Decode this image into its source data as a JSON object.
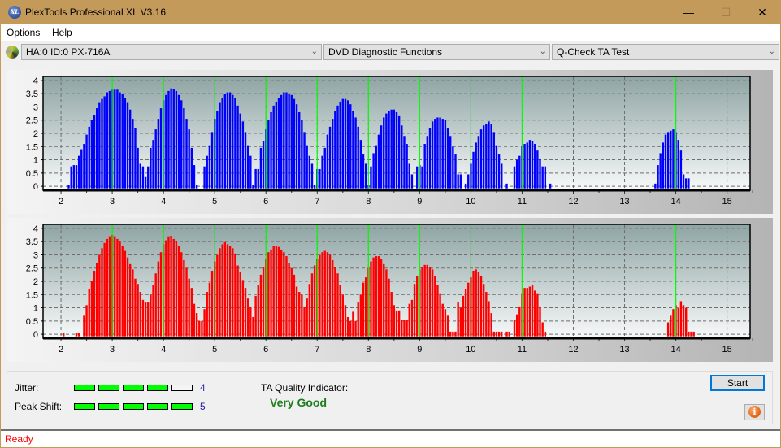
{
  "window": {
    "title": "PlexTools Professional XL V3.16",
    "app_icon": "xl-logo-icon",
    "controls": {
      "minimize": "—",
      "maximize": "☐",
      "close": "✕"
    }
  },
  "menu": {
    "items": [
      {
        "label": "Options"
      },
      {
        "label": "Help"
      }
    ]
  },
  "toolbar": {
    "drive_icon": "disc-drive-icon",
    "drive": "HA:0 ID:0  PX-716A",
    "function": "DVD Diagnostic Functions",
    "test": "Q-Check TA Test"
  },
  "colors": {
    "top_bars": "#0000ff",
    "bottom_bars": "#ff0000",
    "marker_lines": "#00ff00",
    "status_text": "#ff0000",
    "quality_text": "#1e7d1e"
  },
  "chart_data": [
    {
      "type": "bar",
      "name": "TA histogram (top)",
      "color": "#0000ff",
      "xlim": [
        1.65,
        15.45
      ],
      "ylim": [
        -0.15,
        4.15
      ],
      "xticks": [
        2,
        3,
        4,
        5,
        6,
        7,
        8,
        9,
        10,
        11,
        12,
        13,
        14,
        15
      ],
      "yticks": [
        0,
        0.5,
        1,
        1.5,
        2,
        2.5,
        3,
        3.5,
        4
      ],
      "ytick_labels": [
        "0",
        "0.5",
        "1",
        "1.5",
        "2",
        "2.5",
        "3",
        "3.5",
        "4"
      ],
      "marker_lines_x": [
        3,
        4,
        5,
        6,
        7,
        8,
        9,
        10,
        11,
        14
      ],
      "grid": true,
      "x_start": 2.15,
      "x_step": 0.05,
      "values": [
        0.05,
        0.75,
        0.8,
        0.8,
        1.15,
        1.4,
        1.6,
        1.95,
        2.25,
        2.5,
        2.7,
        2.95,
        3.15,
        3.3,
        3.4,
        3.55,
        3.6,
        3.65,
        3.65,
        3.65,
        3.55,
        3.5,
        3.35,
        3.15,
        2.9,
        2.55,
        2.2,
        1.45,
        0.85,
        0.75,
        0.35,
        0.75,
        1.45,
        1.75,
        2.15,
        2.55,
        2.95,
        3.25,
        3.45,
        3.6,
        3.7,
        3.68,
        3.6,
        3.45,
        3.25,
        2.95,
        2.55,
        2.15,
        1.45,
        0.8,
        0.05,
        0,
        0,
        0.75,
        1.15,
        1.55,
        2.05,
        2.55,
        2.85,
        3.15,
        3.35,
        3.5,
        3.55,
        3.55,
        3.45,
        3.35,
        3.05,
        2.75,
        2.45,
        2.05,
        1.55,
        1.15,
        0.05,
        0.65,
        0.65,
        1.45,
        1.7,
        2.15,
        2.5,
        2.8,
        3.05,
        3.2,
        3.35,
        3.45,
        3.55,
        3.55,
        3.5,
        3.45,
        3.3,
        3.1,
        2.8,
        2.5,
        2.05,
        1.55,
        1.15,
        0.85,
        0.05,
        0.65,
        0.65,
        1.15,
        1.45,
        1.95,
        2.25,
        2.55,
        2.85,
        3.05,
        3.2,
        3.3,
        3.3,
        3.25,
        3.1,
        2.85,
        2.6,
        2.25,
        1.75,
        1.2,
        0.85,
        0.05,
        0.75,
        1.25,
        1.55,
        1.95,
        2.3,
        2.6,
        2.75,
        2.85,
        2.9,
        2.9,
        2.8,
        2.65,
        2.3,
        1.9,
        1.6,
        0.85,
        0.45,
        0,
        0.75,
        0.8,
        0.75,
        1.6,
        1.9,
        2.2,
        2.45,
        2.55,
        2.6,
        2.6,
        2.55,
        2.5,
        2.2,
        1.9,
        1.5,
        1.2,
        0.45,
        0.45,
        0,
        0.1,
        0.45,
        0.85,
        1.3,
        1.65,
        1.9,
        2.15,
        2.3,
        2.35,
        2.45,
        2.35,
        2.05,
        1.55,
        1.2,
        0.85,
        0,
        0.1,
        0,
        0,
        0.75,
        1.0,
        1.15,
        1.5,
        1.6,
        1.65,
        1.75,
        1.7,
        1.6,
        1.35,
        1.05,
        0.75,
        0.75,
        0,
        0.1
      ],
      "cluster_14": {
        "x_start": 13.6,
        "x_step": 0.05,
        "values": [
          0.1,
          0.8,
          1.25,
          1.65,
          1.95,
          2.05,
          2.1,
          2.15,
          2.05,
          1.75,
          1.35,
          0.45,
          0.3,
          0.3
        ]
      }
    },
    {
      "type": "bar",
      "name": "TA histogram (bottom)",
      "color": "#ff0000",
      "xlim": [
        1.65,
        15.45
      ],
      "ylim": [
        -0.15,
        4.15
      ],
      "xticks": [
        2,
        3,
        4,
        5,
        6,
        7,
        8,
        9,
        10,
        11,
        12,
        13,
        14,
        15
      ],
      "yticks": [
        0,
        0.5,
        1,
        1.5,
        2,
        2.5,
        3,
        3.5,
        4
      ],
      "ytick_labels": [
        "0",
        "0.5",
        "1",
        "1.5",
        "2",
        "2.5",
        "3",
        "3.5",
        "4"
      ],
      "marker_lines_x": [
        3,
        4,
        5,
        6,
        7,
        8,
        9,
        10,
        11,
        14
      ],
      "grid": true,
      "x_start": 2.05,
      "x_step": 0.05,
      "values": [
        0.05,
        0,
        0,
        0,
        0,
        0.05,
        0.05,
        0,
        0.7,
        1.1,
        1.7,
        2.0,
        2.4,
        2.7,
        3.0,
        3.25,
        3.45,
        3.6,
        3.7,
        3.75,
        3.7,
        3.6,
        3.5,
        3.35,
        3.15,
        2.9,
        2.65,
        2.45,
        2.1,
        1.9,
        1.6,
        1.3,
        1.2,
        1.2,
        1.5,
        1.85,
        2.3,
        2.75,
        3.1,
        3.4,
        3.55,
        3.7,
        3.72,
        3.6,
        3.5,
        3.35,
        3.1,
        2.8,
        2.5,
        2.1,
        1.75,
        1.15,
        0.8,
        0.5,
        0.5,
        0.95,
        1.6,
        1.95,
        2.4,
        2.75,
        3.0,
        3.25,
        3.4,
        3.48,
        3.4,
        3.35,
        3.25,
        3.05,
        2.6,
        2.35,
        2.05,
        1.75,
        1.35,
        1.05,
        0.65,
        1.45,
        1.85,
        2.25,
        2.55,
        2.85,
        3.1,
        3.2,
        3.35,
        3.35,
        3.3,
        3.2,
        3.1,
        2.95,
        2.7,
        2.5,
        2.25,
        1.8,
        1.6,
        1.5,
        1.05,
        1.35,
        1.9,
        2.3,
        2.6,
        2.85,
        3.0,
        3.1,
        3.15,
        3.1,
        3.0,
        2.8,
        2.55,
        2.3,
        1.85,
        1.5,
        1.1,
        0.65,
        0.5,
        0.85,
        0.5,
        1.2,
        1.5,
        1.95,
        2.15,
        2.5,
        2.75,
        2.9,
        2.95,
        2.95,
        2.85,
        2.65,
        2.45,
        2.1,
        1.6,
        1.1,
        0.9,
        0.9,
        0.55,
        0.55,
        0.55,
        1.15,
        1.3,
        1.9,
        2.2,
        2.45,
        2.55,
        2.62,
        2.62,
        2.55,
        2.45,
        2.2,
        1.85,
        1.55,
        1.15,
        0.95,
        0.7,
        0.1,
        0.1,
        0.1,
        1.2,
        1.0,
        1.45,
        1.7,
        1.95,
        2.15,
        2.4,
        2.45,
        2.35,
        2.2,
        1.9,
        1.6,
        1.25,
        0.8,
        0.1,
        0.1,
        0.1,
        0.1,
        0,
        0.1,
        0.1
      ],
      "cluster_11": {
        "x_start": 10.85,
        "x_step": 0.05,
        "values": [
          0.55,
          0.75,
          1.05,
          1.55,
          1.75,
          1.75,
          1.8,
          1.85,
          1.65,
          1.55,
          1.05,
          0.45,
          0.1
        ]
      },
      "cluster_14": {
        "x_start": 13.85,
        "x_step": 0.05,
        "values": [
          0.45,
          0.7,
          0.95,
          1.1,
          1.0,
          1.25,
          1.1,
          1.0,
          0.1,
          0.1,
          0.1
        ]
      }
    }
  ],
  "bottom": {
    "jitter_label": "Jitter:",
    "jitter_value": "4",
    "jitter_level": 4,
    "peak_shift_label": "Peak Shift:",
    "peak_shift_value": "5",
    "peak_shift_level": 5,
    "max_level": 5,
    "ta_quality_label": "TA Quality Indicator:",
    "ta_quality_value": "Very Good",
    "start_label": "Start",
    "info_icon": "i"
  },
  "status": {
    "text": "Ready"
  }
}
